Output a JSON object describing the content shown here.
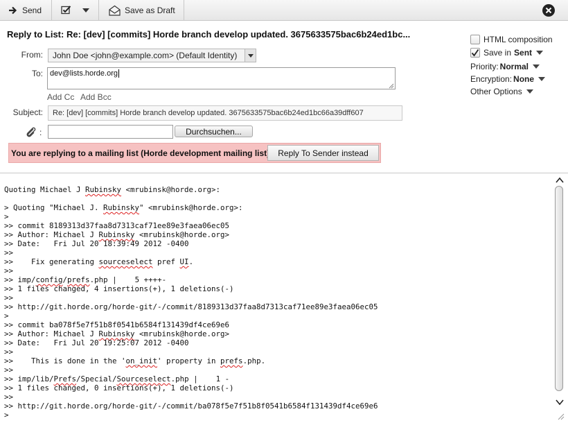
{
  "toolbar": {
    "send_label": "Send",
    "save_draft_label": "Save as Draft",
    "icons": [
      "arrow-right-icon",
      "spellcheck-icon",
      "chevron-down-icon",
      "envelope-icon",
      "close-icon"
    ]
  },
  "title": "Reply to List: Re: [dev] [commits] Horde branch develop updated. 3675633575bac6b24ed1bc...",
  "form": {
    "from_label": "From:",
    "from_value": "John Doe <john@example.com> (Default Identity)",
    "to_label": "To:",
    "to_value": "dev@lists.horde.org",
    "add_cc": "Add Cc",
    "add_bcc": "Add Bcc",
    "subject_label": "Subject:",
    "subject_value": "Re: [dev] [commits] Horde branch develop updated. 3675633575bac6b24ed1bc66a39dff607",
    "attach_colon": ":",
    "browse_label": "Durchsuchen...",
    "mailing_list_notice": "You are replying to a mailing list (Horde development mailing list).",
    "reply_sender_label": "Reply To Sender instead"
  },
  "options": {
    "html_composition": "HTML composition",
    "html_composition_checked": false,
    "save_in_label": "Save in",
    "save_in_value": "Sent",
    "save_in_checked": true,
    "priority_label": "Priority:",
    "priority_value": "Normal",
    "encryption_label": "Encryption:",
    "encryption_value": "None",
    "other_options": "Other Options"
  },
  "colors": {
    "banner_bg": "#f6c2c2",
    "toolbar_bg": "#ececec",
    "spell_underline": "#dd2222"
  },
  "body": {
    "lines": [
      "Quoting Michael J Rubinsky <mrubinsk@horde.org>:",
      "",
      "> Quoting \"Michael J. Rubinsky\" <mrubinsk@horde.org>:",
      ">",
      ">> commit 8189313d37faa8d7313caf71ee89e3faea06ec05",
      ">> Author: Michael J Rubinsky <mrubinsk@horde.org>",
      ">> Date:   Fri Jul 20 18:39:49 2012 -0400",
      ">>",
      ">>    Fix generating sourceselect pref UI.",
      ">>",
      ">> imp/config/prefs.php |    5 ++++-",
      ">> 1 files changed, 4 insertions(+), 1 deletions(-)",
      ">>",
      ">> http://git.horde.org/horde-git/-/commit/8189313d37faa8d7313caf71ee89e3faea06ec05",
      ">",
      ">> commit ba078f5e7f51b8f0541b6584f131439df4ce69e6",
      ">> Author: Michael J Rubinsky <mrubinsk@horde.org>",
      ">> Date:   Fri Jul 20 19:25:07 2012 -0400",
      ">>",
      ">>    This is done in the 'on_init' property in prefs.php.",
      ">>",
      ">> imp/lib/Prefs/Special/Sourceselect.php |    1 -",
      ">> 1 files changed, 0 insertions(+), 1 deletions(-)",
      ">>",
      ">> http://git.horde.org/horde-git/-/commit/ba078f5e7f51b8f0541b6584f131439df4ce69e6",
      ">"
    ],
    "misspelled": [
      "Rubinsky",
      "sourceselect",
      "UI",
      "config",
      "prefs",
      "on_init",
      "Prefs",
      "Sourceselect"
    ]
  }
}
